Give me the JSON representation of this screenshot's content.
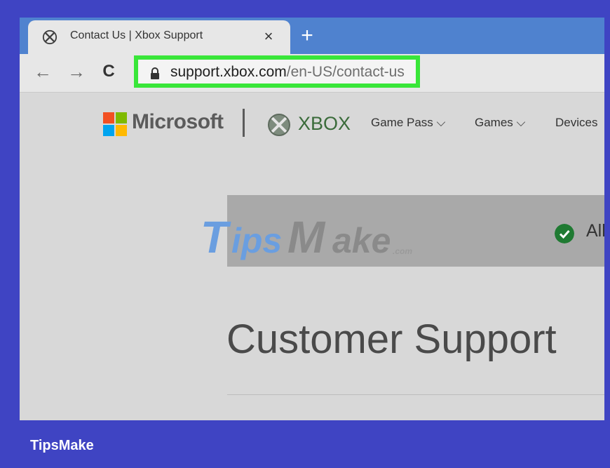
{
  "browser": {
    "tab": {
      "title": "Contact Us | Xbox Support",
      "close": "×"
    },
    "new_tab": "+",
    "nav": {
      "back": "←",
      "forward": "→",
      "reload": "C"
    },
    "url": {
      "host": "support.xbox.com",
      "path": "/en-US/contact-us"
    }
  },
  "header": {
    "microsoft": "Microsoft",
    "xbox": "XBOX",
    "nav_items": [
      "Game Pass ⌵",
      "Games ⌵",
      "Devices"
    ]
  },
  "banner": {
    "text": "All"
  },
  "watermark": {
    "text": "TipsMake",
    "suffix": ".com"
  },
  "main": {
    "heading": "Customer Support"
  },
  "footer": {
    "brand": "TipsMake"
  },
  "colors": {
    "frame_bg": "#3f44c3",
    "tabstrip": "#4f82cf",
    "highlight": "#39e639",
    "xbox_green": "#3a6b3a",
    "check_green": "#1f7a32"
  }
}
